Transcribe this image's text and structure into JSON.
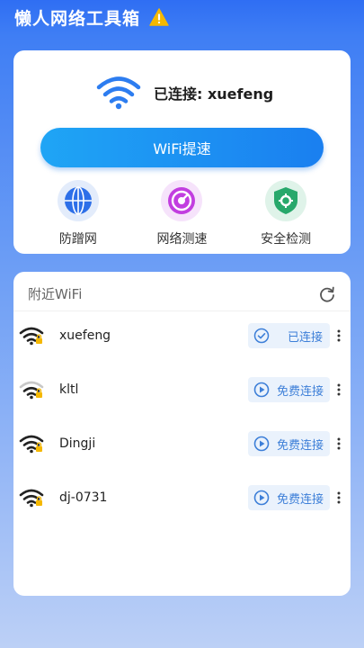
{
  "header": {
    "title": "懒人网络工具箱",
    "icon": "warning-icon",
    "warning_color": "#f5b800"
  },
  "connection": {
    "status_text": "已连接: xuefeng",
    "icon": "wifi-icon"
  },
  "boost_button": {
    "label": "WiFi提速"
  },
  "tools": [
    {
      "label": "防蹭网",
      "icon": "globe-icon",
      "color": "#2d6fe8"
    },
    {
      "label": "网络测速",
      "icon": "speedometer-icon",
      "color": "#c23ee0"
    },
    {
      "label": "安全检测",
      "icon": "shield-icon",
      "color": "#27a86b"
    }
  ],
  "nearby": {
    "title": "附近WiFi",
    "networks": [
      {
        "ssid": "xuefeng",
        "action": "已连接",
        "state": "connected"
      },
      {
        "ssid": "kltl",
        "action": "免费连接",
        "state": "available"
      },
      {
        "ssid": "Dingji",
        "action": "免费连接",
        "state": "available"
      },
      {
        "ssid": "dj-0731",
        "action": "免费连接",
        "state": "available"
      }
    ]
  }
}
